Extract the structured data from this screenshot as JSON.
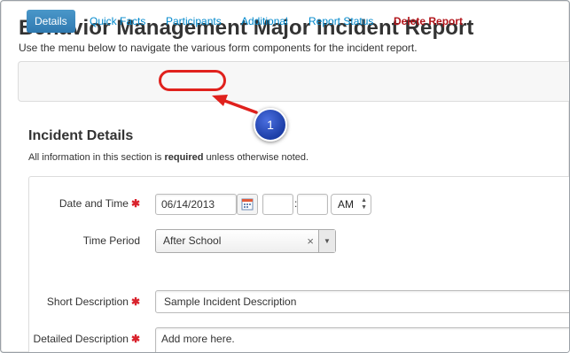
{
  "header": {
    "title": "Behavior Management Major Incident Report",
    "subtitle": "Use the menu below to navigate the various form components for the incident report."
  },
  "tabs": [
    {
      "label": "Details",
      "active": true
    },
    {
      "label": "Quick Facts"
    },
    {
      "label": "Participants",
      "highlighted": true
    },
    {
      "label": "Additional"
    },
    {
      "label": "Report Status"
    },
    {
      "label": "Delete Report",
      "danger": true
    }
  ],
  "callout": {
    "number": "1"
  },
  "section": {
    "title": "Incident Details",
    "note_prefix": "All information in this section is ",
    "note_bold": "required",
    "note_suffix": " unless otherwise noted."
  },
  "form": {
    "date_time_label": "Date and Time",
    "date_value": "06/14/2013",
    "hour_value": "",
    "time_separator": ":",
    "minute_value": "",
    "ampm_value": "AM",
    "time_period_label": "Time Period",
    "time_period_value": "After School",
    "short_desc_label": "Short Description",
    "short_desc_value": "Sample Incident Description",
    "detailed_desc_label": "Detailed Description",
    "detailed_desc_value": "Add more here.",
    "required_marker": "✱"
  },
  "colors": {
    "link": "#0088cc",
    "active_tab": "#3a87ad",
    "danger": "#b1141a",
    "required": "#d9232d",
    "annotation_red": "#e0211d",
    "callout_blue": "#2a4fc0"
  }
}
